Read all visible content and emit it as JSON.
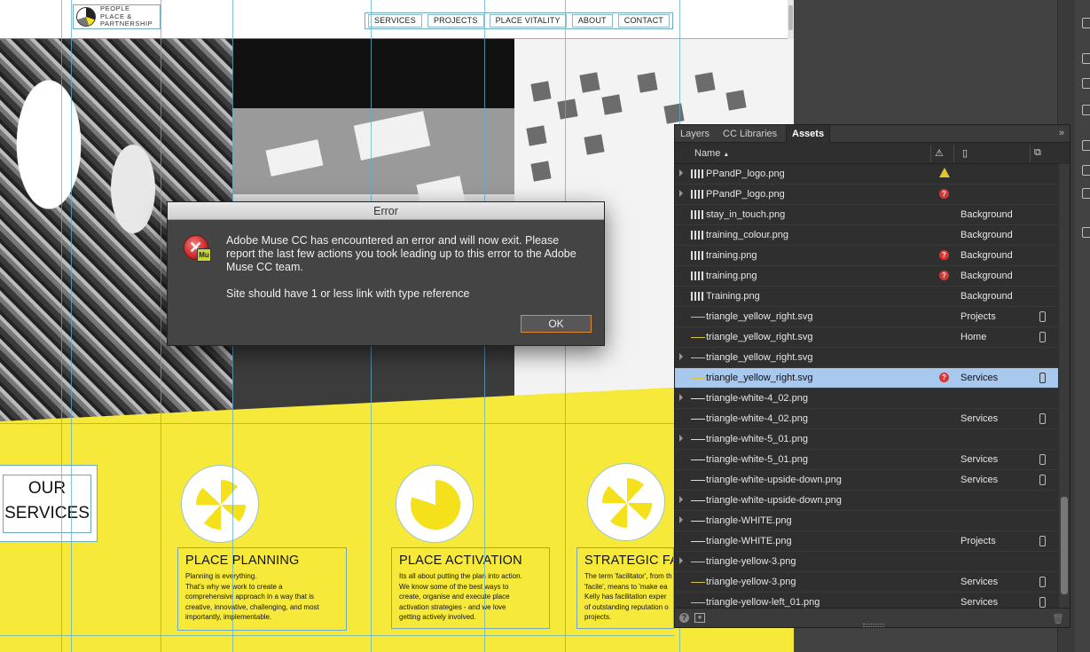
{
  "website": {
    "logo_text": "PEOPLE\nPLACE &\nPARTNERSHIP",
    "nav": [
      "SERVICES",
      "PROJECTS",
      "PLACE VITALITY",
      "ABOUT",
      "CONTACT"
    ],
    "services_title": "OUR\nSERVICES",
    "cards": [
      {
        "title": "PLACE PLANNING",
        "body": "Planning is everything.\nThat's why we work to create a\ncomprehensive approach in a way that is\ncreative, innovative, challenging, and most\nimportantly, implementable."
      },
      {
        "title": "PLACE ACTIVATION",
        "body": "Its all about putting the plan into action.\nWe know some of the best ways to\ncreate, organise and execute place\nactivation strategies - and we love\ngetting actively involved."
      },
      {
        "title": "STRATEGIC FA",
        "body": "The term 'facilitator', from th\n'facile', means to 'make ea\nKelly has facilitation exper\nof outstanding reputation o\nprojects."
      }
    ]
  },
  "panel": {
    "tabs": [
      "Layers",
      "CC Libraries",
      "Assets"
    ],
    "active_tab": "Assets",
    "column_name": "Name",
    "collapse_glyph": "»",
    "rows": [
      {
        "name": "PPandP_logo.png",
        "expand": true,
        "status": "warn-triangle",
        "page": "",
        "device": false
      },
      {
        "name": "PPandP_logo.png",
        "expand": true,
        "status": "error",
        "page": "",
        "device": false
      },
      {
        "name": "stay_in_touch.png",
        "expand": false,
        "status": "",
        "page": "Background",
        "device": false
      },
      {
        "name": "training_colour.png",
        "expand": false,
        "status": "",
        "page": "Background",
        "device": false
      },
      {
        "name": "training.png",
        "expand": false,
        "status": "error",
        "page": "Background",
        "device": false
      },
      {
        "name": "training.png",
        "expand": false,
        "status": "error",
        "page": "Background",
        "device": false
      },
      {
        "name": "Training.png",
        "expand": false,
        "status": "",
        "page": "Background",
        "device": false
      },
      {
        "name": "triangle_yellow_right.svg",
        "expand": false,
        "status": "",
        "page": "Projects",
        "device": true
      },
      {
        "name": "triangle_yellow_right.svg",
        "expand": false,
        "status": "",
        "page": "Home",
        "device": true
      },
      {
        "name": "triangle_yellow_right.svg",
        "expand": true,
        "status": "",
        "page": "",
        "device": false
      },
      {
        "name": "triangle_yellow_right.svg",
        "expand": false,
        "status": "error",
        "page": "Services",
        "device": true,
        "selected": true
      },
      {
        "name": "triangle-white-4_02.png",
        "expand": true,
        "status": "",
        "page": "",
        "device": false
      },
      {
        "name": "triangle-white-4_02.png",
        "expand": false,
        "status": "",
        "page": "Services",
        "device": true
      },
      {
        "name": "triangle-white-5_01.png",
        "expand": true,
        "status": "",
        "page": "",
        "device": false
      },
      {
        "name": "triangle-white-5_01.png",
        "expand": false,
        "status": "",
        "page": "Services",
        "device": true
      },
      {
        "name": "triangle-white-upside-down.png",
        "expand": false,
        "status": "",
        "page": "Services",
        "device": true
      },
      {
        "name": "triangle-white-upside-down.png",
        "expand": true,
        "status": "",
        "page": "",
        "device": false
      },
      {
        "name": "triangle-WHITE.png",
        "expand": true,
        "status": "",
        "page": "",
        "device": false
      },
      {
        "name": "triangle-WHITE.png",
        "expand": false,
        "status": "",
        "page": "Projects",
        "device": true
      },
      {
        "name": "triangle-yellow-3.png",
        "expand": true,
        "status": "",
        "page": "",
        "device": false
      },
      {
        "name": "triangle-yellow-3.png",
        "expand": false,
        "status": "",
        "page": "Services",
        "device": true
      },
      {
        "name": "triangle-yellow-left_01.png",
        "expand": false,
        "status": "",
        "page": "Services",
        "device": true
      }
    ]
  },
  "dialog": {
    "title": "Error",
    "icon_badge": "Mu",
    "message": "Adobe Muse CC has encountered an error and will now exit. Please report the last few actions you took leading up to this error to the Adobe Muse CC team.",
    "detail": "Site should have 1 or less link with type reference",
    "ok_label": "OK"
  },
  "colors": {
    "accent_yellow": "#f7e93a",
    "selection": "#a9c8ee",
    "error_red": "#d83434",
    "ok_border": "#e18a2f",
    "guide": "#5fb0d0"
  }
}
